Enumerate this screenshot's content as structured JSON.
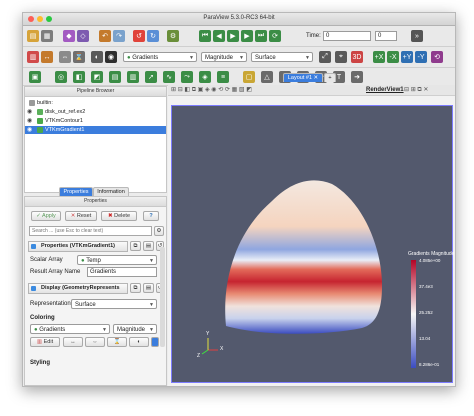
{
  "window": {
    "title": "ParaView 5.3.0-RC3 64-bit",
    "traffic_colors": [
      "#fc5f57",
      "#fdbc2e",
      "#28c840"
    ]
  },
  "toolbar_top": {
    "time_label": "Time:",
    "time_value": "0",
    "time_index": "0"
  },
  "toolbar_color": {
    "array_selector": "Gradients",
    "component_selector": "Magnitude",
    "representation_selector": "Surface"
  },
  "pipeline_browser": {
    "header": "Pipeline Browser",
    "items": [
      {
        "label": "builtin:",
        "icon": "server-icon",
        "color": "#9a9a9a",
        "indent": 0
      },
      {
        "label": "disk_out_ref.ex2",
        "icon": "file-reader-icon",
        "color": "#5bb05b",
        "indent": 1
      },
      {
        "label": "VTKmContour1",
        "icon": "filter-icon",
        "color": "#4aa84a",
        "indent": 1
      },
      {
        "label": "VTKmGradient1",
        "icon": "filter-icon",
        "color": "#4aa84a",
        "indent": 1
      }
    ],
    "selected_index": 3
  },
  "panel_tabs": {
    "properties": "Properties",
    "information": "Information"
  },
  "properties_panel": {
    "header": "Properties",
    "apply_label": "Apply",
    "reset_label": "Reset",
    "delete_label": "Delete",
    "help_label": "?",
    "search_placeholder": "Search ... (use Esc to clear text)",
    "section_properties": "Properties (VTKmGradient1)",
    "scalar_array_label": "Scalar Array",
    "scalar_array_value": "Temp",
    "result_array_label": "Result Array Name",
    "result_array_value": "Gradients",
    "section_display": "Display (GeometryRepresents",
    "representation_label": "Representation",
    "representation_value": "Surface",
    "coloring_label": "Coloring",
    "coloring_array": "Gradients",
    "coloring_component": "Magnitude",
    "edit_label": "Edit",
    "styling_label": "Styling"
  },
  "layout": {
    "tab_label": "Layout #1",
    "view_label": "RenderView1"
  },
  "colorbar": {
    "title": "Gradients Magnitude",
    "ticks": [
      "4.085e+00",
      "37.4e3",
      "25.252",
      "13.04",
      "8.286e-01"
    ],
    "colors": [
      "#b40426",
      "#f7f7f7",
      "#3b4cc0"
    ]
  },
  "axes": {
    "x": "X",
    "y": "Y",
    "z": "Z"
  },
  "colors": {
    "render_background": "#53596d",
    "selection_highlight": "#3b7ddd"
  }
}
